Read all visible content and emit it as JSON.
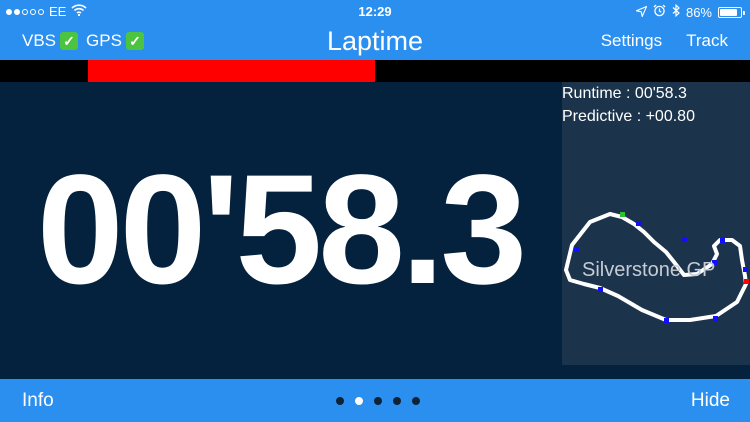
{
  "status_bar": {
    "signal_bars_full": 2,
    "signal_bars_total": 5,
    "carrier": "EE",
    "time": "12:29",
    "battery_text": "86%",
    "battery_level": 0.86,
    "icons": [
      "wifi-icon",
      "location-arrow-icon",
      "alarm-clock-icon",
      "bluetooth-icon"
    ]
  },
  "nav": {
    "vbs_label": "VBS",
    "gps_label": "GPS",
    "check_glyph": "✓",
    "title": "Laptime",
    "settings_label": "Settings",
    "track_label": "Track"
  },
  "delta_bar": {
    "start_fraction": 0.117,
    "end_fraction": 0.5,
    "color": "#ff0000"
  },
  "main": {
    "lap_time": "00'58.3",
    "runtime_label": "Runtime : 00'58.3",
    "predictive_label": "Predictive : +00.80"
  },
  "track_map": {
    "name": "Silverstone GP",
    "marker_colors": {
      "sector": "#1010ff",
      "start": "#2fc02f",
      "finish": "#ff0000"
    }
  },
  "bottom_bar": {
    "info_label": "Info",
    "hide_label": "Hide",
    "page_count": 5,
    "active_page": 2
  },
  "colors": {
    "accent": "#2b8ff0",
    "background": "#04223d",
    "panel": "#1c334c"
  }
}
